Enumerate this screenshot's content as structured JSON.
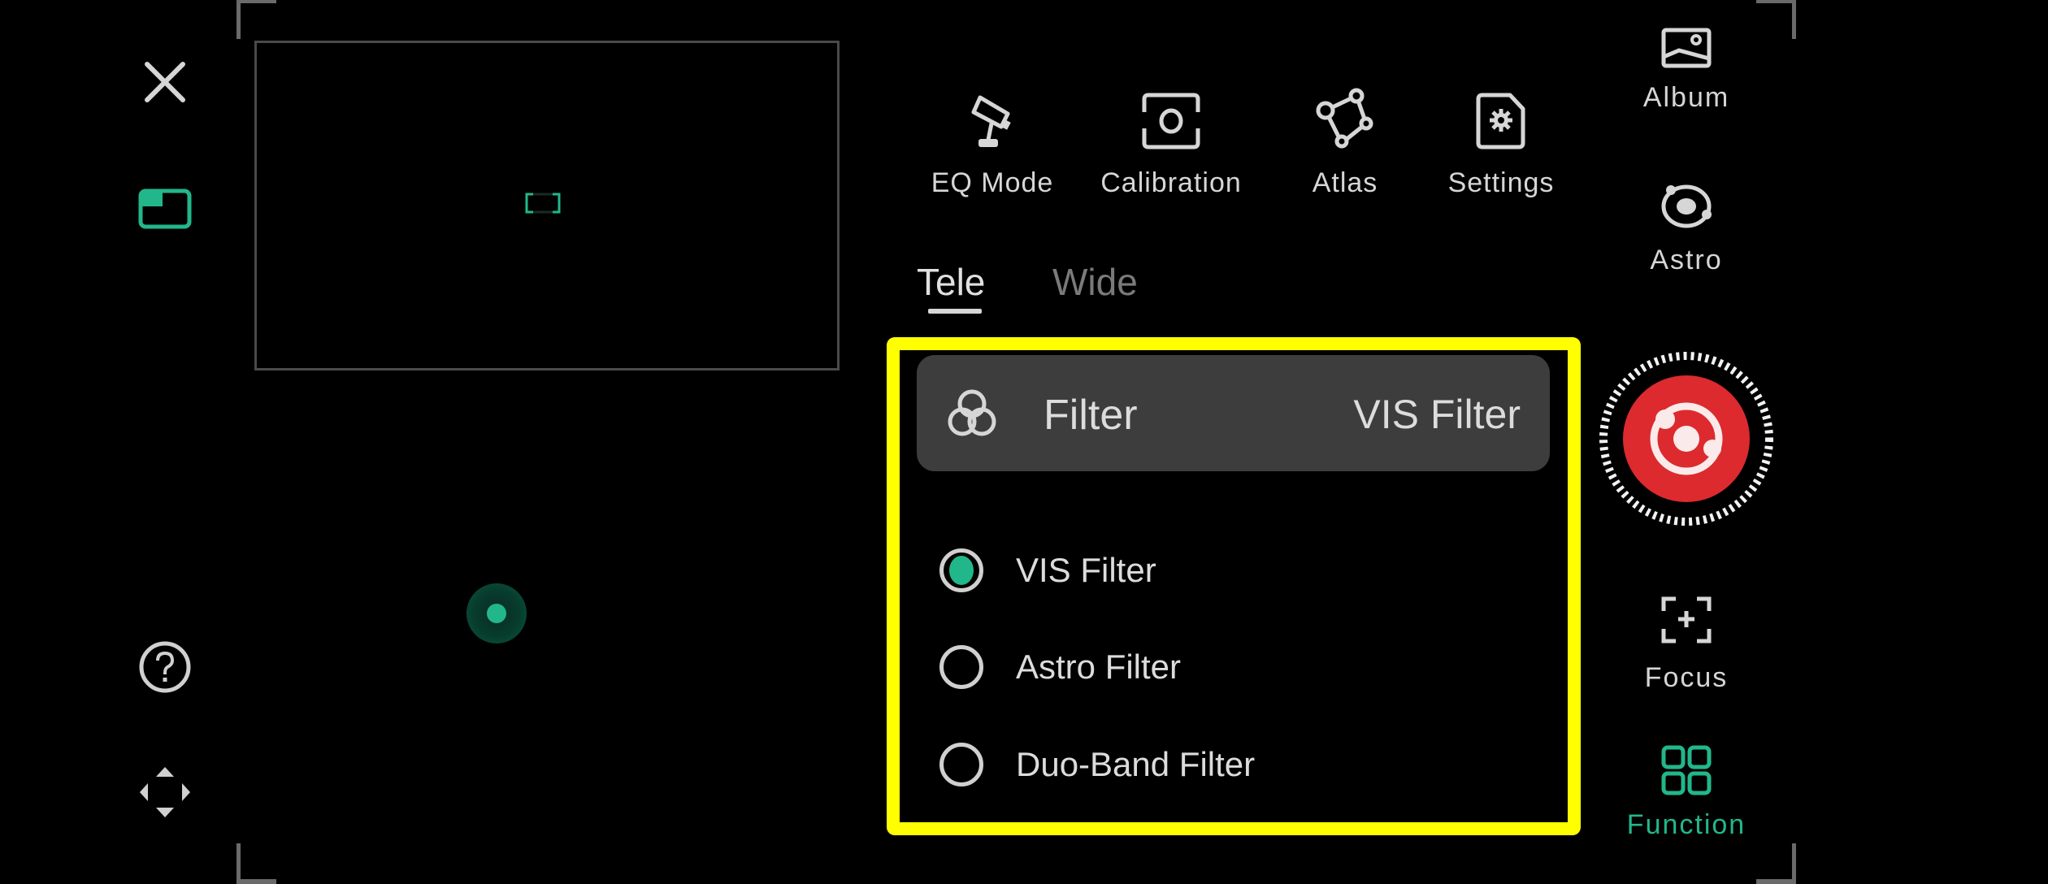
{
  "left_bar": {
    "close_icon": "close-icon",
    "layout_icon": "picture-in-picture-icon",
    "help_icon": "help-circle-icon",
    "move_icon": "four-way-arrows-icon"
  },
  "preview": {
    "marker_icon": "target-bracket-icon"
  },
  "toolbar": {
    "items": [
      {
        "label": "EQ Mode",
        "icon": "telescope-icon"
      },
      {
        "label": "Calibration",
        "icon": "calibration-icon"
      },
      {
        "label": "Atlas",
        "icon": "constellation-icon"
      },
      {
        "label": "Settings",
        "icon": "settings-file-icon"
      }
    ]
  },
  "tabs": [
    {
      "label": "Tele",
      "active": true
    },
    {
      "label": "Wide",
      "active": false
    }
  ],
  "filter_panel": {
    "title": "Filter",
    "current_value": "VIS Filter",
    "icon": "filter-circles-icon",
    "options": [
      {
        "label": "VIS Filter",
        "selected": true
      },
      {
        "label": "Astro Filter",
        "selected": false
      },
      {
        "label": "Duo-Band Filter",
        "selected": false
      }
    ]
  },
  "right_bar": {
    "album": {
      "label": "Album",
      "icon": "image-icon"
    },
    "astro": {
      "label": "Astro",
      "icon": "orbit-icon"
    },
    "shutter": {
      "icon": "astro-shutter-icon"
    },
    "focus": {
      "label": "Focus",
      "icon": "focus-plus-icon"
    },
    "function": {
      "label": "Function",
      "icon": "grid-icon",
      "active": true
    }
  },
  "colors": {
    "accent": "#22b78a",
    "highlight": "#ffff00",
    "shutter": "#dc2a2f",
    "panel": "#3c3d3c"
  }
}
